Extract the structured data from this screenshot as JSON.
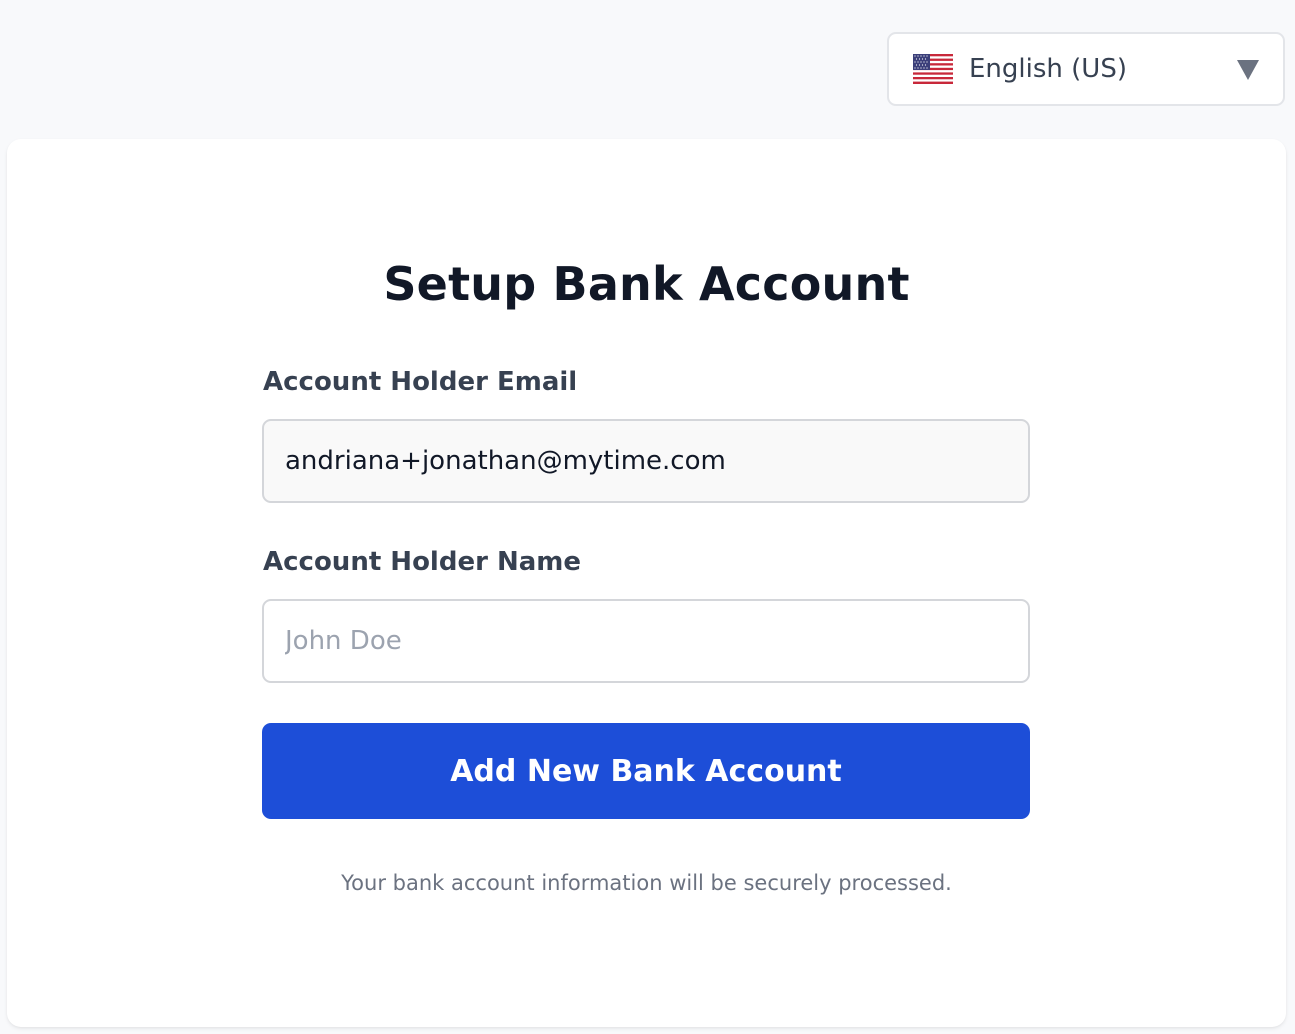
{
  "language_selector": {
    "label": "English (US)",
    "flag_icon": "us-flag-icon",
    "dropdown_icon": "triangle-down-icon"
  },
  "form": {
    "title": "Setup Bank Account",
    "email_label": "Account Holder Email",
    "email_value": "andriana+jonathan@mytime.com",
    "name_label": "Account Holder Name",
    "name_value": "",
    "name_placeholder": "John Doe",
    "submit_label": "Add New Bank Account",
    "security_note": "Your bank account information will be securely processed."
  },
  "colors": {
    "primary_button": "#1d4ed8",
    "page_background": "#f8f9fb",
    "card_background": "#ffffff"
  }
}
